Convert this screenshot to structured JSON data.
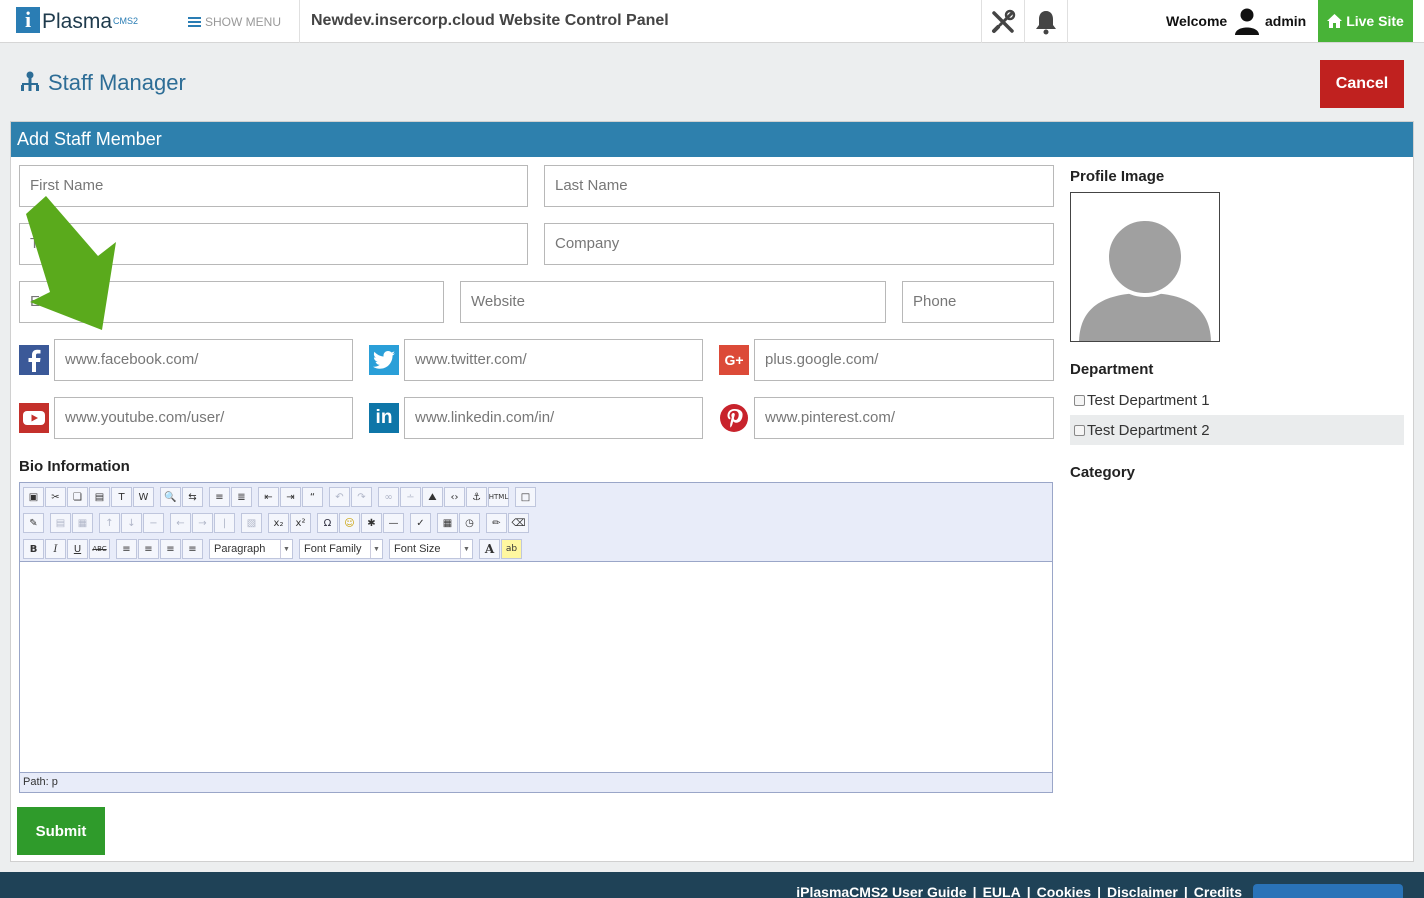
{
  "app": {
    "logo_text": "Plasma",
    "logo_letter": "i",
    "logo_sup": "CMS2",
    "show_menu": "SHOW MENU",
    "site_title": "Newdev.insercorp.cloud Website Control Panel",
    "welcome": "Welcome",
    "username": "admin",
    "live_site": "Live Site"
  },
  "page": {
    "title": "Staff Manager",
    "cancel_label": "Cancel",
    "panel_title": "Add Staff Member"
  },
  "form": {
    "first_name": "First Name",
    "last_name": "Last Name",
    "title": "T",
    "company": "Company",
    "email": "Em",
    "website": "Website",
    "phone": "Phone",
    "facebook": "www.facebook.com/",
    "twitter": "www.twitter.com/",
    "google": "plus.google.com/",
    "youtube": "www.youtube.com/user/",
    "linkedin": "www.linkedin.com/in/",
    "pinterest": "www.pinterest.com/",
    "bio_label": "Bio Information",
    "submit_label": "Submit"
  },
  "editor": {
    "format_select": "Paragraph",
    "font_family_select": "Font Family",
    "font_size_select": "Font Size",
    "path": "Path: p"
  },
  "sidebar": {
    "profile_image_label": "Profile Image",
    "department_label": "Department",
    "departments": [
      "Test Department 1",
      "Test Department 2"
    ],
    "category_label": "Category"
  },
  "footer": {
    "links": [
      "iPlasmaCMS2 User Guide",
      "EULA",
      "Cookies",
      "Disclaimer",
      "Credits"
    ]
  },
  "colors": {
    "brand_blue": "#2e80ad",
    "live_site_green": "#48b337",
    "cancel_red": "#c0211f",
    "submit_green": "#2f9b2b",
    "footer_bg": "#1f4257",
    "arrow_green": "#5aaa1c"
  }
}
